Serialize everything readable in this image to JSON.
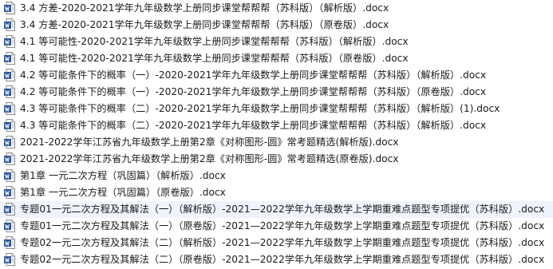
{
  "file_list": {
    "icon_type": "word-document-icon",
    "colors": {
      "icon_blue": "#2b579a",
      "text": "#1a1a1a",
      "selected_row": "#eef4fb"
    },
    "files": [
      {
        "name": "3.4 方差-2020-2021学年九年级数学上册同步课堂帮帮帮（苏科版）（解析版）.docx"
      },
      {
        "name": "3.4 方差-2020-2021学年九年级数学上册同步课堂帮帮帮（苏科版）（原卷版）.docx"
      },
      {
        "name": "4.1 等可能性-2020-2021学年九年级数学上册同步课堂帮帮帮（苏科版）（解析版）.docx"
      },
      {
        "name": "4.1 等可能性-2020-2021学年九年级数学上册同步课堂帮帮帮（苏科版）（原卷版）.docx"
      },
      {
        "name": "4.2 等可能条件下的概率（一）-2020-2021学年九年级数学上册同步课堂帮帮帮（苏科版）（解析版）.docx"
      },
      {
        "name": "4.2 等可能条件下的概率（一）-2020-2021学年九年级数学上册同步课堂帮帮帮（苏科版）（原卷版）.docx"
      },
      {
        "name": "4.3 等可能条件下的概率（二）-2020-2021学年九年级数学上册同步课堂帮帮帮（苏科版）（解析版）(1).docx"
      },
      {
        "name": "4.3 等可能条件下的概率（二）-2020-2021学年九年级数学上册同步课堂帮帮帮（苏科版）（解析版）.docx"
      },
      {
        "name": "2021-2022学年江苏省九年级数学上册第2章《对称图形-圆》常考题精选(解析版).docx"
      },
      {
        "name": "2021-2022学年江苏省九年级数学上册第2章《对称图形-圆》常考题精选(原卷版).docx"
      },
      {
        "name": "第1章  一元二次方程（巩固篇）（解析版）.docx"
      },
      {
        "name": "第1章  一元二次方程（巩固篇）（原卷版）.docx"
      },
      {
        "name": "专题01一元二次方程及其解法（一）（解析版）-2021—2022学年九年级数学上学期重难点题型专项提优（苏科版）.docx"
      },
      {
        "name": "专题01一元二次方程及其解法（一）（原卷版）-2021—2022学年九年级数学上学期重难点题型专项提优（苏科版）.docx"
      },
      {
        "name": "专题02一元二次方程及其解法（二）（解析版）-2021—2022学年九年级数学上学期重难点题型专项提优（苏科版）.docx"
      },
      {
        "name": "专题02一元二次方程及其解法（二）（原卷版）-2021—2022学年九年级数学上学期重难点题型专项提优（苏科版）.docx"
      }
    ]
  }
}
